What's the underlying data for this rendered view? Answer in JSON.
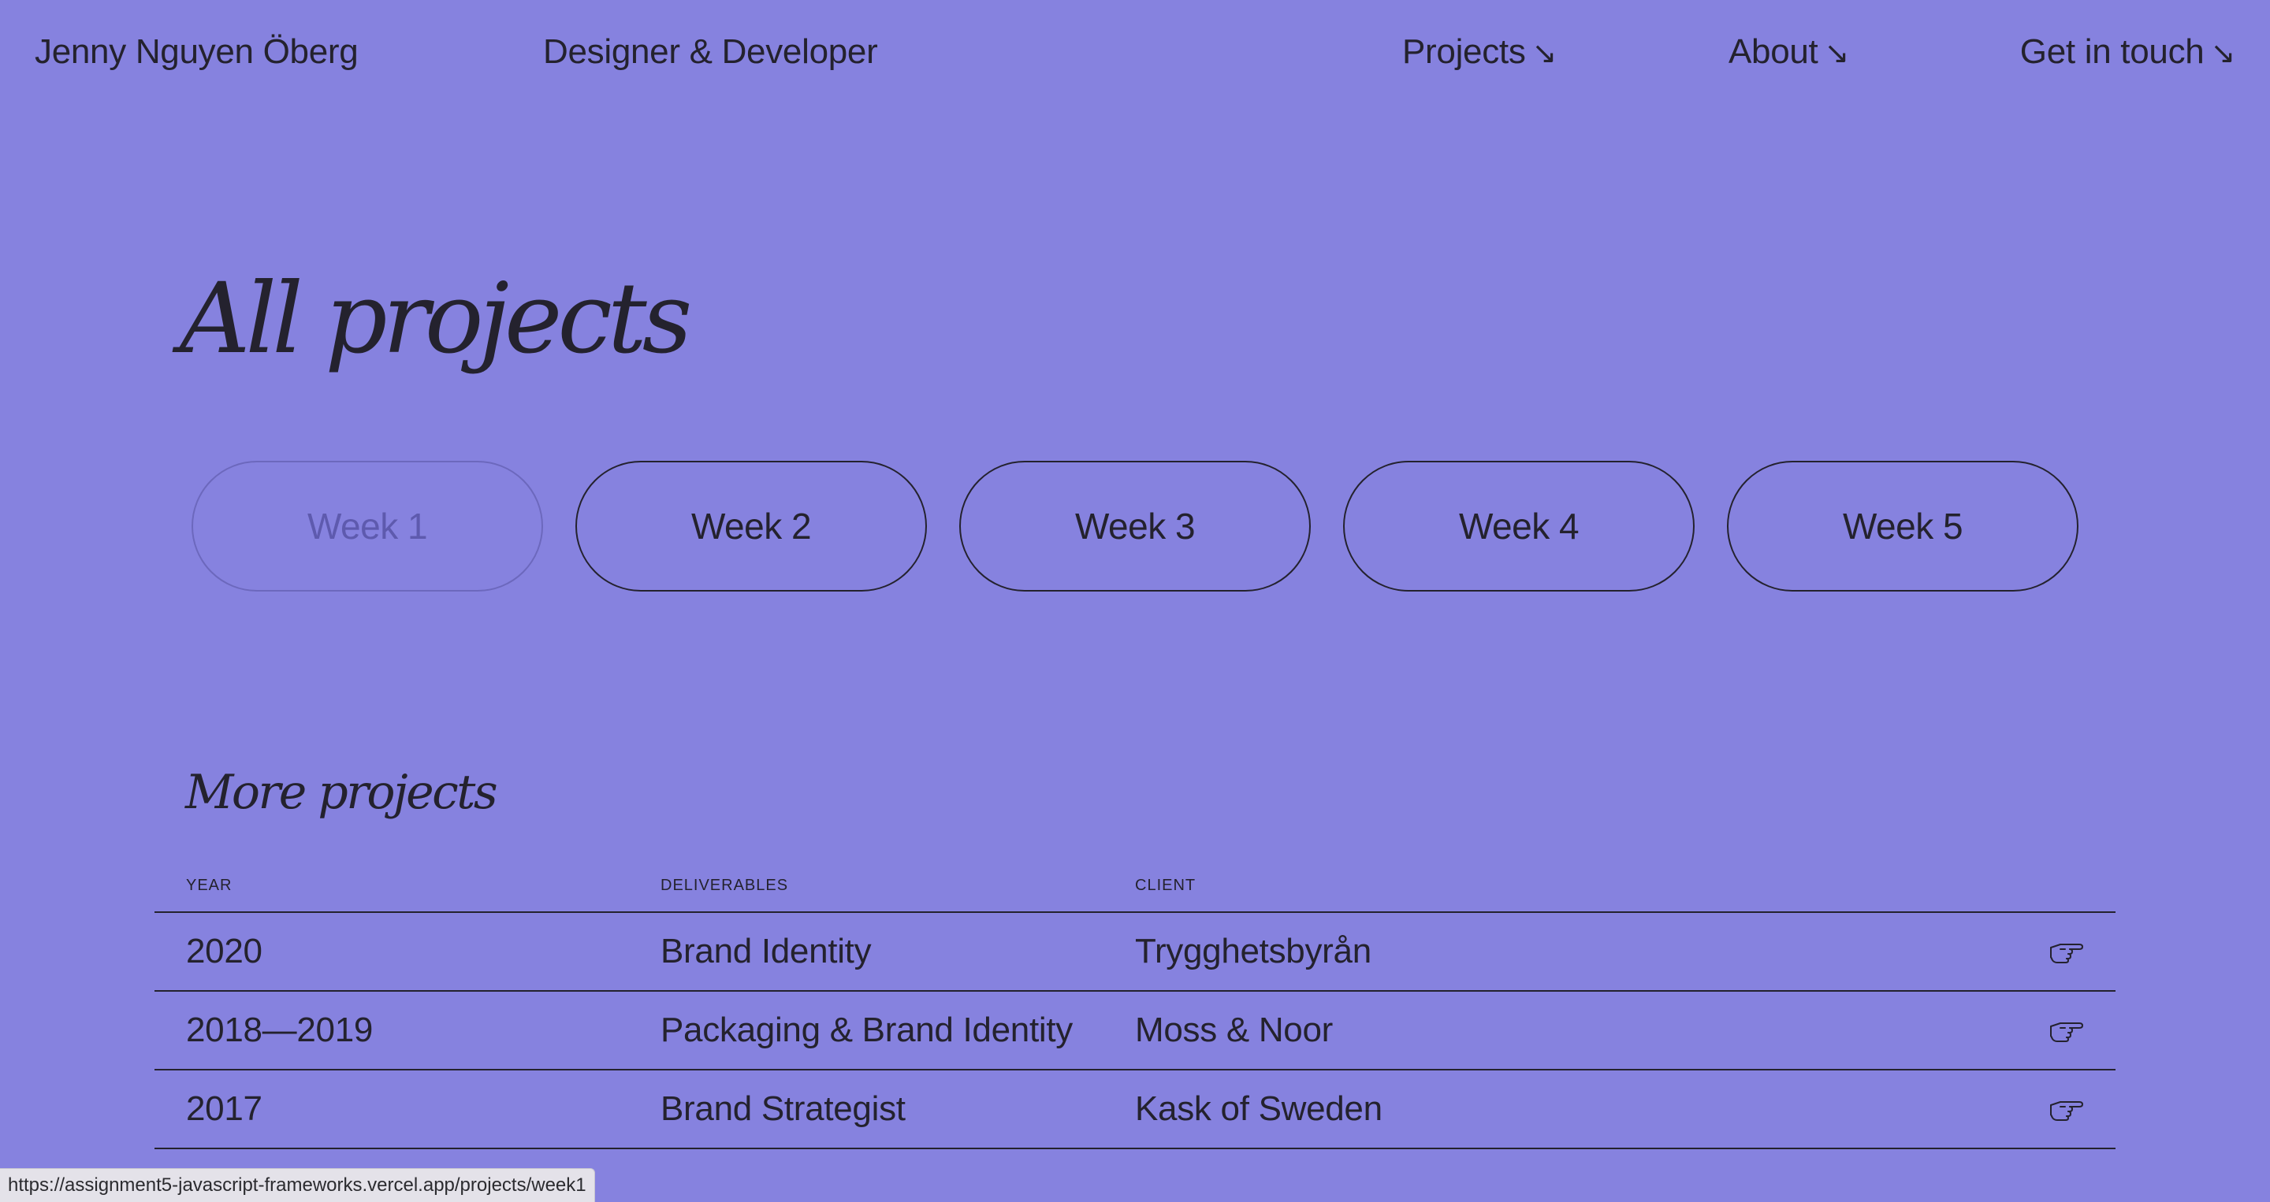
{
  "header": {
    "name": "Jenny Nguyen Öberg",
    "role": "Designer & Developer",
    "nav": [
      {
        "label": "Projects",
        "arrow": "↘"
      },
      {
        "label": "About",
        "arrow": "↘"
      },
      {
        "label": "Get in touch",
        "arrow": "↘"
      }
    ]
  },
  "page_title": "All projects",
  "weeks": [
    {
      "label": "Week 1",
      "state": "disabled"
    },
    {
      "label": "Week 2",
      "state": "enabled"
    },
    {
      "label": "Week 3",
      "state": "enabled"
    },
    {
      "label": "Week 4",
      "state": "enabled"
    },
    {
      "label": "Week 5",
      "state": "enabled"
    }
  ],
  "more_projects": {
    "title": "More projects",
    "columns": [
      "YEAR",
      "DELIVERABLES",
      "CLIENT"
    ],
    "rows": [
      {
        "year": "2020",
        "deliverables": "Brand Identity",
        "client": "Trygghetsbyrån",
        "icon": "pointing-hand-icon"
      },
      {
        "year": "2018—2019",
        "deliverables": "Packaging & Brand Identity",
        "client": "Moss & Noor",
        "icon": "pointing-hand-icon"
      },
      {
        "year": "2017",
        "deliverables": "Brand Strategist",
        "client": "Kask of Sweden",
        "icon": "pointing-hand-icon"
      }
    ]
  },
  "status_bar": {
    "url": "https://assignment5-javascript-frameworks.vercel.app/projects/week1"
  },
  "colors": {
    "background": "#8682df",
    "text": "#24222e",
    "disabled_text": "#5e5aae",
    "status_bar_bg": "#e4e2e9"
  }
}
